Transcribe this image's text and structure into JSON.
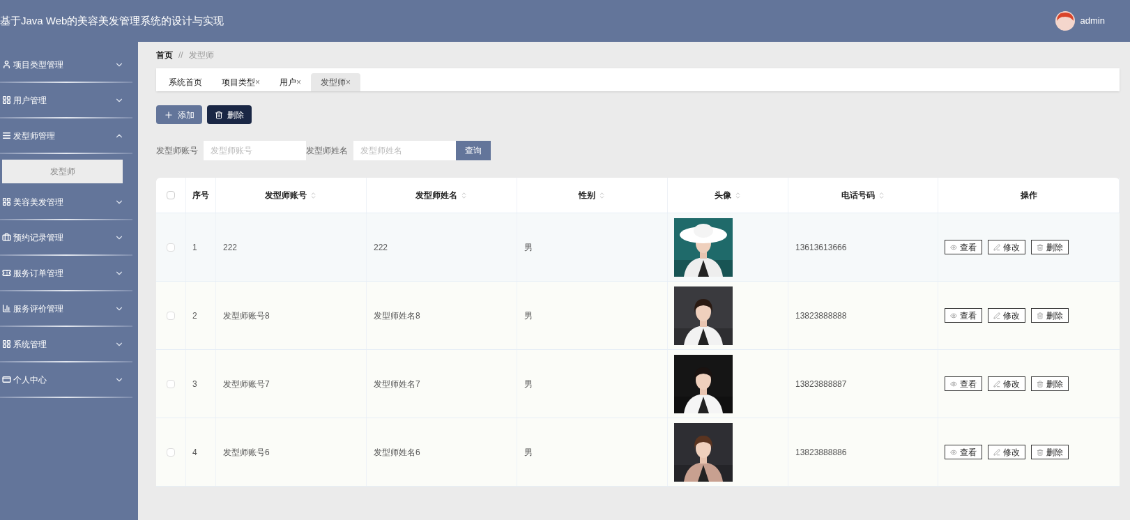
{
  "header": {
    "title": "基于Java Web的美容美发管理系统的设计与实现",
    "user": "admin"
  },
  "sidebar": {
    "items": [
      {
        "label": "项目类型管理",
        "expanded": false
      },
      {
        "label": "用户管理",
        "expanded": false
      },
      {
        "label": "发型师管理",
        "expanded": true,
        "children": [
          {
            "label": "发型师",
            "selected": true
          }
        ]
      },
      {
        "label": "美容美发管理",
        "expanded": false
      },
      {
        "label": "预约记录管理",
        "expanded": false
      },
      {
        "label": "服务订单管理",
        "expanded": false
      },
      {
        "label": "服务评价管理",
        "expanded": false
      },
      {
        "label": "系统管理",
        "expanded": false
      },
      {
        "label": "个人中心",
        "expanded": false
      }
    ]
  },
  "breadcrumb": {
    "home": "首页",
    "separator": "//",
    "current": "发型师"
  },
  "tabs": [
    {
      "label": "系统首页",
      "selected": false
    },
    {
      "label": "项目类型",
      "close": "×",
      "selected": false
    },
    {
      "label": "用户",
      "close": "×",
      "selected": false
    },
    {
      "label": "发型师",
      "close": "×",
      "selected": true
    }
  ],
  "actions": [
    {
      "label": "添加",
      "kind": "add"
    },
    {
      "label": "删除",
      "kind": "delete"
    }
  ],
  "search": {
    "fields": [
      {
        "label": "发型师账号",
        "placeholder": "发型师账号"
      },
      {
        "label": "发型师姓名",
        "placeholder": "发型师姓名"
      }
    ],
    "button": "查询"
  },
  "table": {
    "columns": [
      {
        "label": "序号",
        "sortable": false
      },
      {
        "label": "发型师账号",
        "sortable": true
      },
      {
        "label": "发型师姓名",
        "sortable": true
      },
      {
        "label": "性别",
        "sortable": true
      },
      {
        "label": "头像",
        "sortable": true
      },
      {
        "label": "电话号码",
        "sortable": true
      },
      {
        "label": "操作",
        "sortable": false
      }
    ],
    "all_checked": false,
    "rows": [
      {
        "checked": false,
        "index": "1",
        "account": "222",
        "name": "222",
        "gender": "男",
        "phone": "13613613666",
        "photo": {
          "kind": "picture"
        },
        "actions": [
          "查看",
          "修改",
          "删除"
        ]
      },
      {
        "checked": false,
        "index": "2",
        "account": "发型师账号8",
        "name": "发型师姓名8",
        "gender": "男",
        "phone": "13823888888",
        "photo": {
          "kind": "picture"
        },
        "actions": [
          "查看",
          "修改",
          "删除"
        ]
      },
      {
        "checked": false,
        "index": "3",
        "account": "发型师账号7",
        "name": "发型师姓名7",
        "gender": "男",
        "phone": "13823888887",
        "photo": {
          "kind": "picture"
        },
        "actions": [
          "查看",
          "修改",
          "删除"
        ]
      },
      {
        "checked": false,
        "index": "4",
        "account": "发型师账号6",
        "name": "发型师姓名6",
        "gender": "男",
        "phone": "13823888886",
        "photo": {
          "kind": "picture"
        },
        "actions": [
          "查看",
          "修改",
          "删除"
        ]
      }
    ]
  }
}
